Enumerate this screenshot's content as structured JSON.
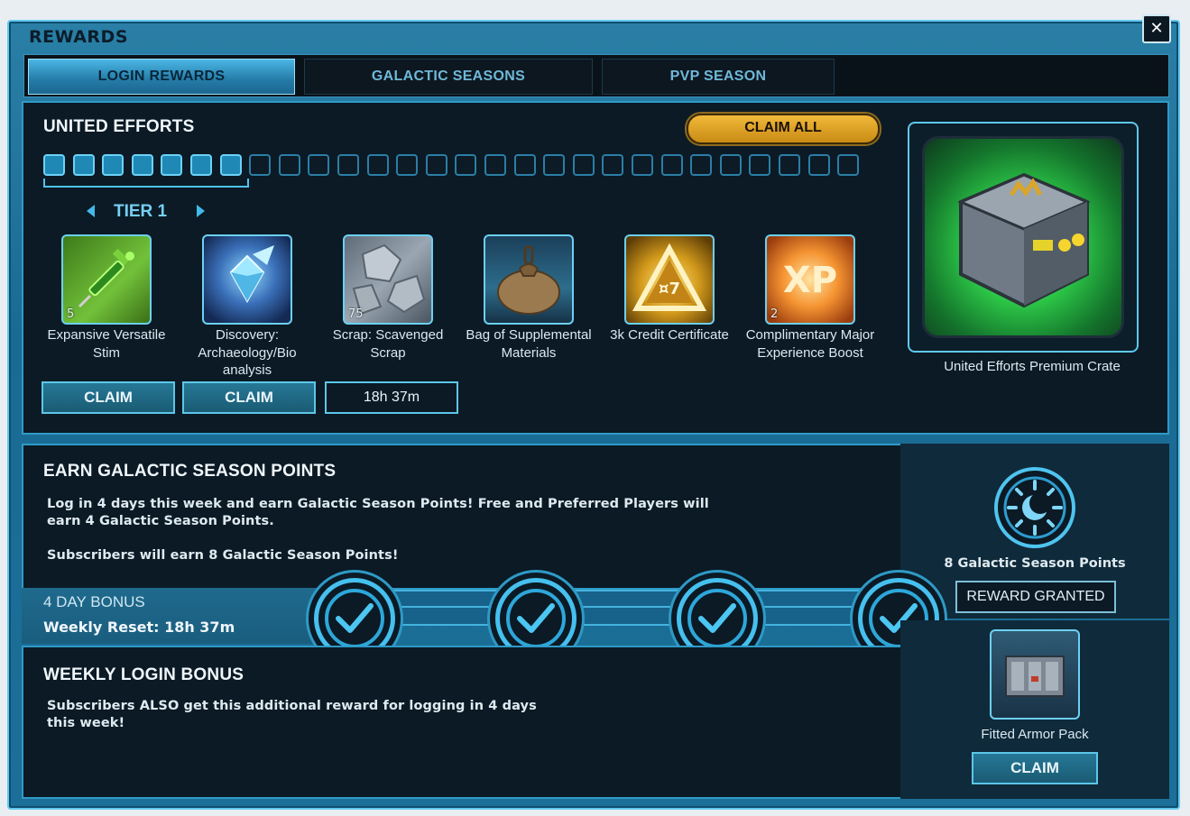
{
  "window": {
    "title": "REWARDS",
    "close_label": "✕"
  },
  "tabs": [
    {
      "label": "LOGIN REWARDS",
      "active": true
    },
    {
      "label": "GALACTIC SEASONS",
      "active": false
    },
    {
      "label": "PVP SEASON",
      "active": false
    }
  ],
  "united_efforts": {
    "title": "UNITED EFFORTS",
    "claim_all_label": "CLAIM ALL",
    "progress": {
      "completed": 7,
      "total": 28
    },
    "tier_label": "TIER 1",
    "rewards": [
      {
        "name": "Expansive Versatile Stim",
        "quantity": "5",
        "action": "CLAIM",
        "icon": "stim-icon"
      },
      {
        "name": "Discovery: Archaeology/Bio analysis",
        "quantity": "",
        "action": "CLAIM",
        "icon": "crystal-icon"
      },
      {
        "name": "Scrap: Scavenged Scrap",
        "quantity": "75",
        "action": "18h 37m",
        "icon": "scrap-icon"
      },
      {
        "name": "Bag of Supplemental Materials",
        "quantity": "",
        "action": "",
        "icon": "bag-icon"
      },
      {
        "name": "3k Credit Certificate",
        "quantity": "",
        "action": "",
        "icon": "credit-certificate-icon"
      },
      {
        "name": "Complimentary Major Experience Boost",
        "quantity": "2",
        "action": "",
        "icon": "xp-boost-icon"
      }
    ],
    "premium_crate_name": "United Efforts Premium Crate"
  },
  "galactic_points": {
    "title": "EARN GALACTIC SEASON POINTS",
    "line1": "Log in 4 days this week and earn Galactic Season Points!  Free and Preferred Players will",
    "line2": "earn 4 Galactic Season Points.",
    "line3": "Subscribers will earn 8 Galactic Season Points!",
    "reward_label": "8 Galactic Season Points",
    "reward_status": "REWARD GRANTED"
  },
  "day_bonus": {
    "title": "4 DAY BONUS",
    "reset": "Weekly Reset: 18h 37m",
    "days_checked": 4
  },
  "weekly_bonus": {
    "title": "WEEKLY LOGIN BONUS",
    "line1": "Subscribers ALSO get this additional reward for logging in 4 days",
    "line2": "this week!",
    "reward_label": "Fitted Armor Pack",
    "claim_label": "CLAIM"
  },
  "colors": {
    "accent": "#2f9ac7",
    "claim_all": "#e2a72a",
    "panel": "#0b1a25"
  }
}
